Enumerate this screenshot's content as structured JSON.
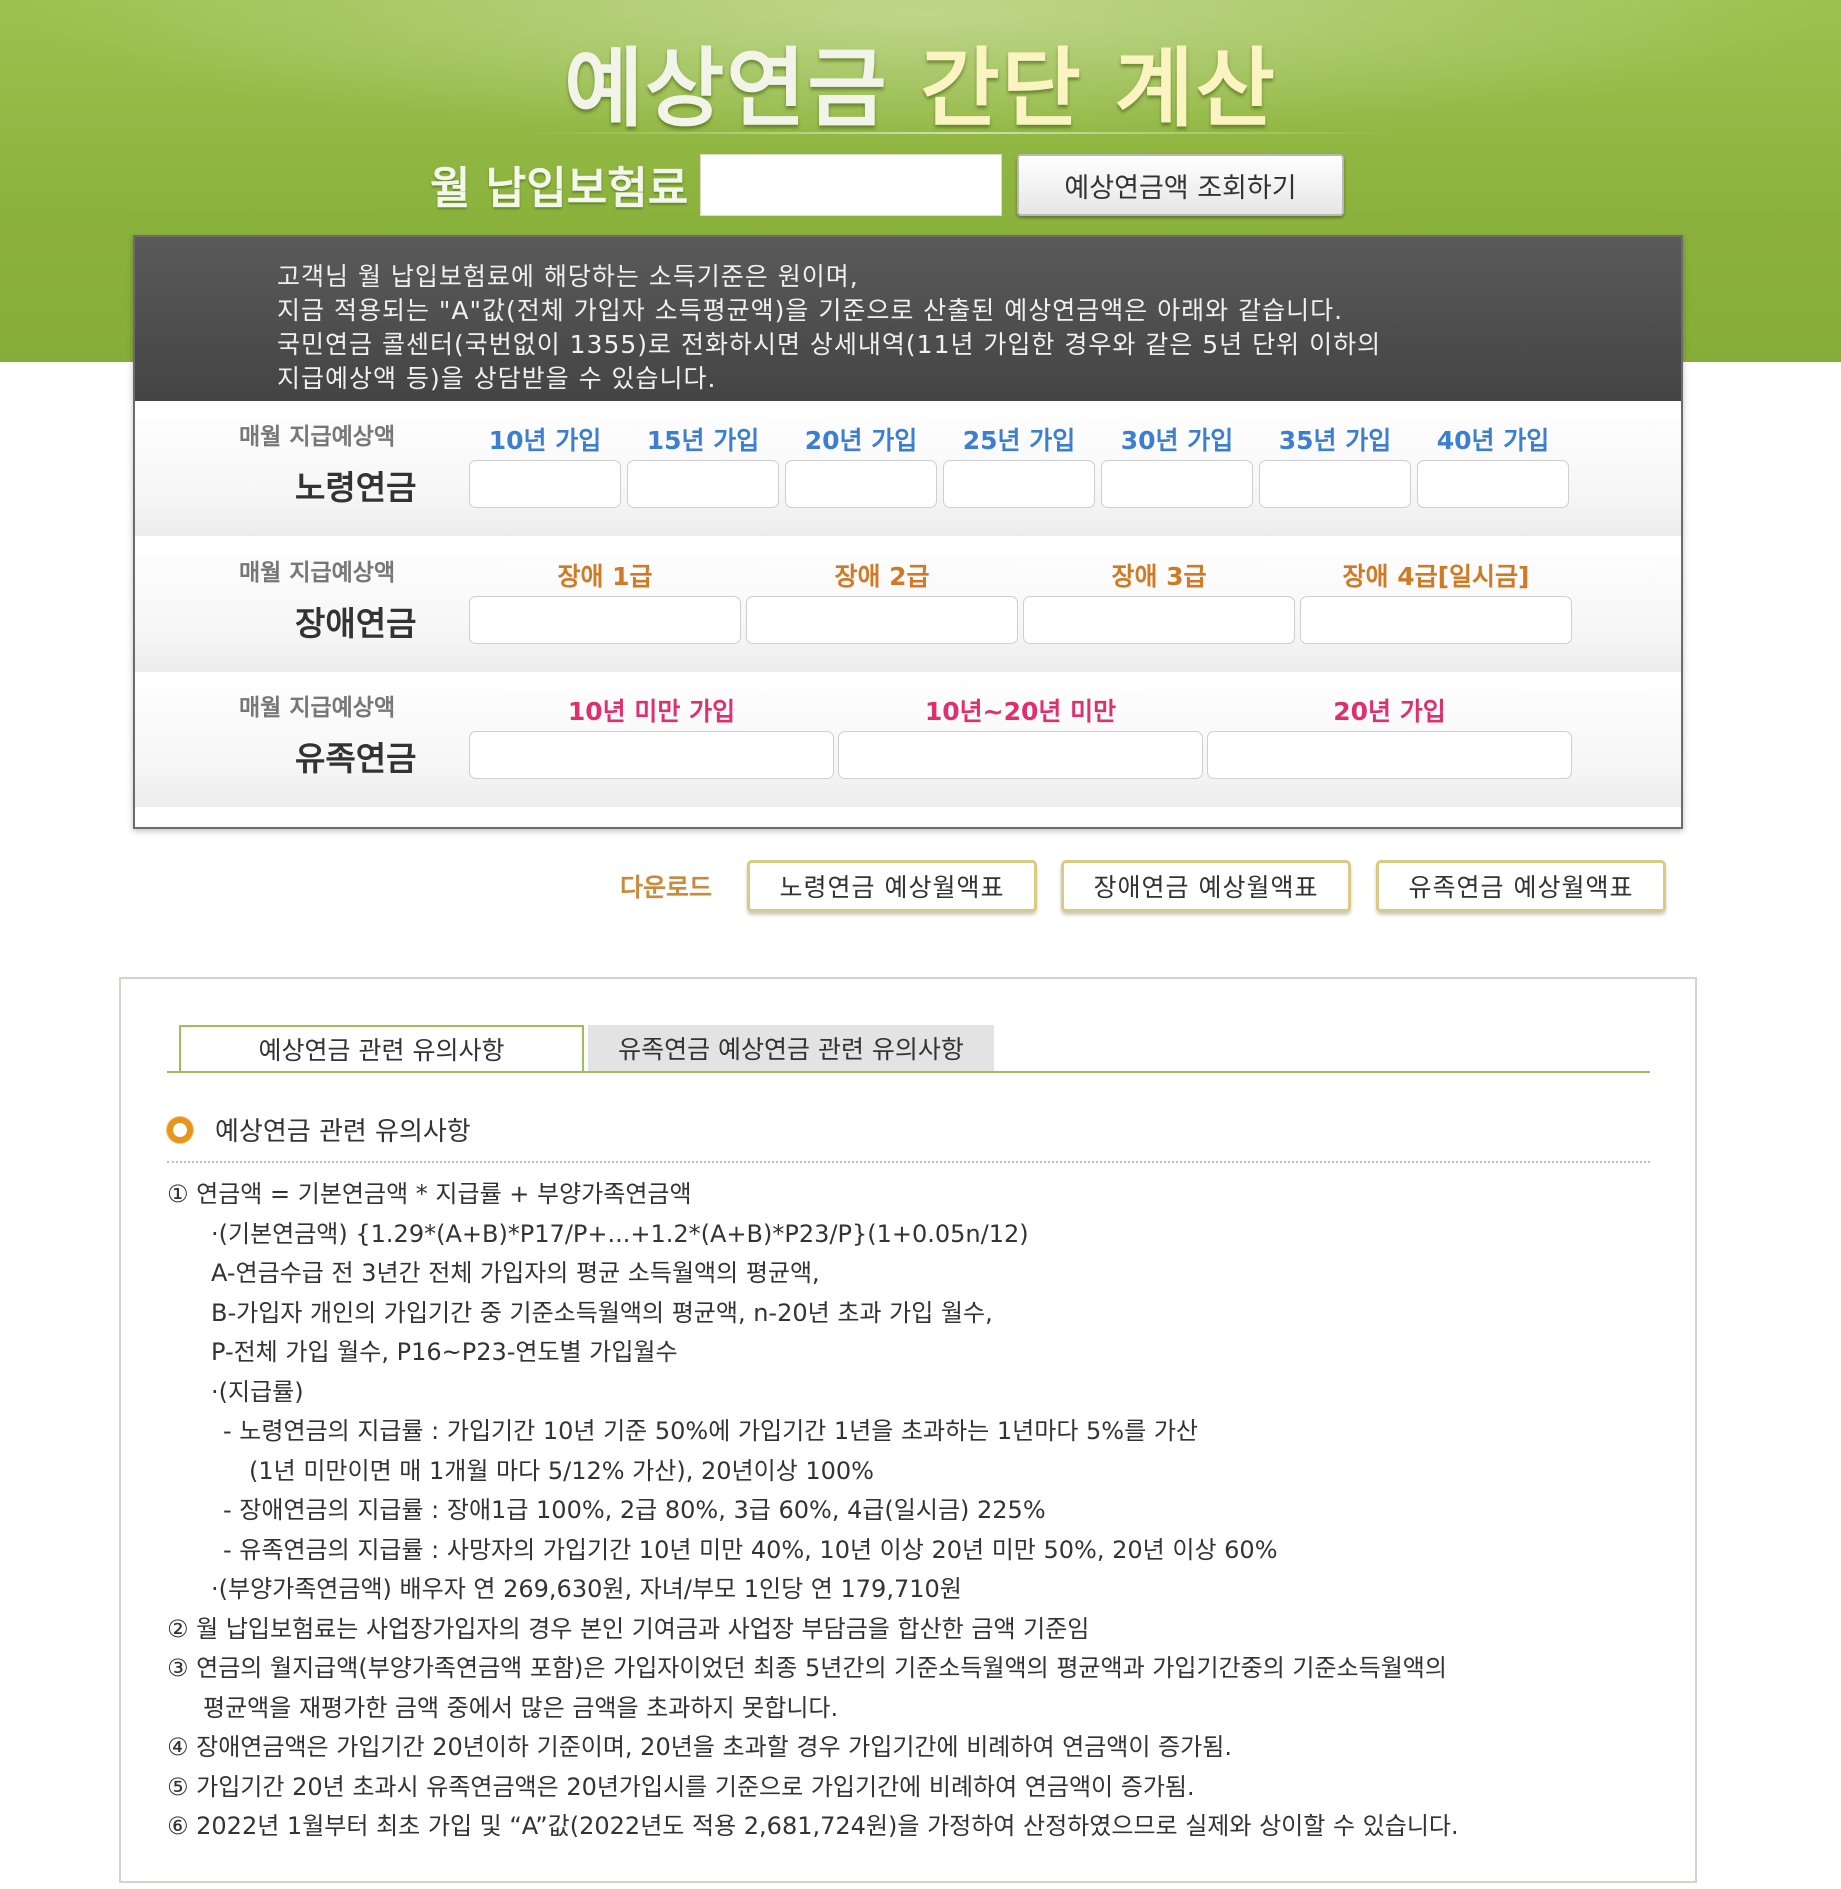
{
  "header": {
    "title_part1": "예상연금",
    "title_part2": "간단 계산",
    "premium_label": "월 납입보험료",
    "premium_input_value": "",
    "lookup_button": "예상연금액 조회하기"
  },
  "intro": {
    "line1": "고객님 월 납입보험료에 해당하는 소득기준은   원이며,",
    "line2": "지금 적용되는 \"A\"값(전체 가입자 소득평균액)을 기준으로 산출된 예상연금액은 아래와 같습니다.",
    "line3": "국민연금 콜센터(국번없이 1355)로 전화하시면 상세내역(11년 가입한 경우와 같은 5년 단위 이하의",
    "line4": "지급예상액 등)을 상담받을 수 있습니다."
  },
  "old_age": {
    "sub": "매월 지급예상액",
    "title": "노령연금",
    "columns": [
      "10년 가입",
      "15년 가입",
      "20년 가입",
      "25년 가입",
      "30년 가입",
      "35년 가입",
      "40년 가입"
    ]
  },
  "disability": {
    "sub": "매월 지급예상액",
    "title": "장애연금",
    "columns": [
      "장애 1급",
      "장애 2급",
      "장애 3급",
      "장애 4급[일시금]"
    ]
  },
  "survivor": {
    "sub": "매월 지급예상액",
    "title": "유족연금",
    "columns": [
      "10년 미만 가입",
      "10년~20년 미만",
      "20년 가입"
    ]
  },
  "download": {
    "label": "다운로드",
    "buttons": [
      "노령연금 예상월액표",
      "장애연금 예상월액표",
      "유족연금 예상월액표"
    ]
  },
  "notice": {
    "tabs": [
      "예상연금 관련 유의사항",
      "유족연금 예상연금 관련 유의사항"
    ],
    "heading": "예상연금 관련 유의사항",
    "lines": [
      "① 연금액 = 기본연금액 * 지급률 + 부양가족연금액",
      "·(기본연금액) {1.29*(A+B)*P17/P+...+1.2*(A+B)*P23/P}(1+0.05n/12)",
      "A-연금수급 전 3년간 전체 가입자의 평균 소득월액의 평균액,",
      "B-가입자 개인의 가입기간 중 기준소득월액의 평균액, n-20년 초과 가입 월수,",
      "P-전체 가입 월수, P16~P23-연도별 가입월수",
      "·(지급률)",
      "- 노령연금의 지급률 : 가입기간 10년 기준 50%에 가입기간 1년을 초과하는 1년마다 5%를 가산",
      "(1년 미만이면 매 1개월 마다 5/12% 가산), 20년이상 100%",
      "- 장애연금의 지급률 : 장애1급 100%, 2급 80%, 3급 60%, 4급(일시금) 225%",
      "- 유족연금의 지급률 : 사망자의 가입기간 10년 미만 40%, 10년 이상 20년 미만 50%, 20년 이상 60%",
      "·(부양가족연금액) 배우자 연 269,630원, 자녀/부모 1인당 연 179,710원",
      "② 월 납입보험료는 사업장가입자의 경우 본인 기여금과 사업장 부담금을 합산한 금액 기준임",
      "③ 연금의 월지급액(부양가족연금액 포함)은 가입자이었던 최종 5년간의 기준소득월액의 평균액과 가입기간중의 기준소득월액의",
      "평균액을 재평가한 금액 중에서 많은 금액을 초과하지 못합니다.",
      "④ 장애연금액은 가입기간 20년이하 기준이며, 20년을 초과할 경우 가입기간에 비례하여 연금액이 증가됨.",
      "⑤ 가입기간 20년 초과시 유족연금액은 20년가입시를 기준으로 가입기간에 비례하여 연금액이 증가됨.",
      "⑥ 2022년 1월부터 최초 가입 및 “A”값(2022년도 적용 2,681,724원)을 가정하여 산정하였으므로 실제와 상이할 수 있습니다."
    ]
  },
  "colors": {
    "band_green": "#8db33f",
    "panel_dark": "#4a4a4a",
    "old_age_label": "#3c7fd0",
    "disability_label": "#d17a26",
    "survivor_label": "#df2f6d",
    "download_label": "#c98a3c",
    "tab_border": "#9bbf59",
    "heading_bullet": "#e6951d"
  }
}
